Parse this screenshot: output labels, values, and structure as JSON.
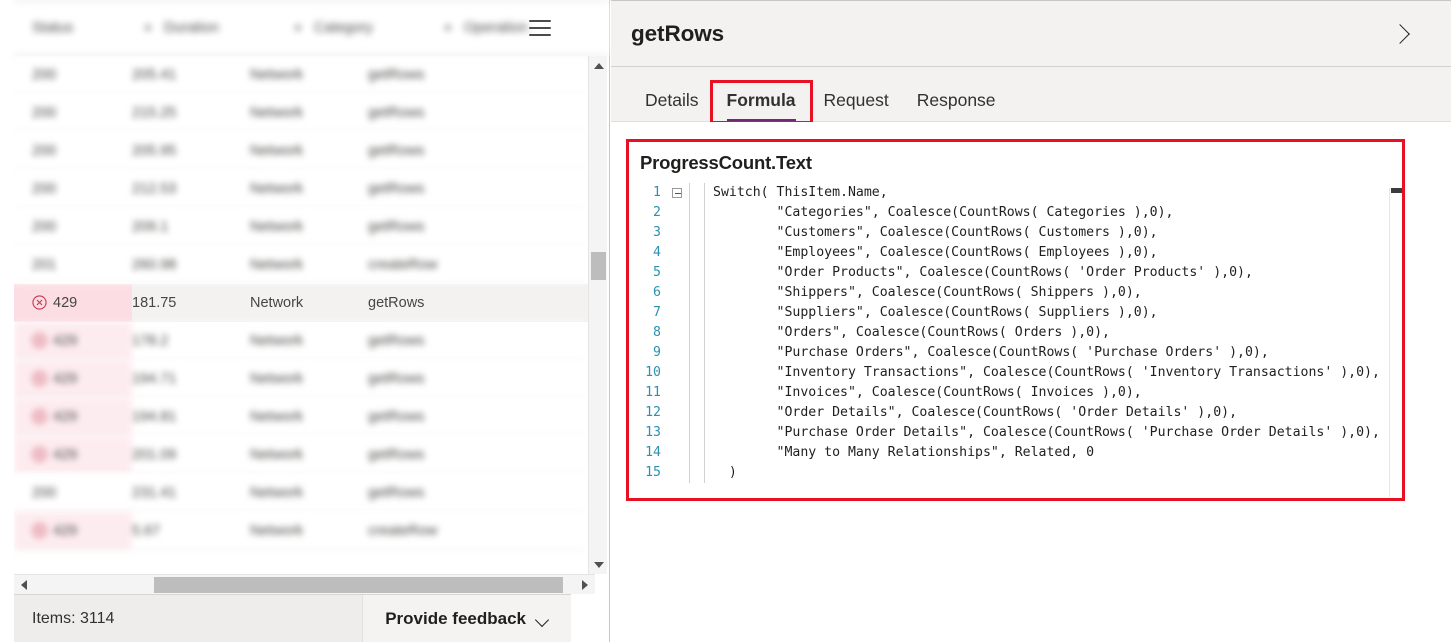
{
  "grid": {
    "columns": [
      "Status",
      "Duration",
      "Category",
      "Operation"
    ],
    "sort_icon": "sort-icon",
    "menu_icon": "hamburger-menu-icon",
    "rows": [
      {
        "status": "200",
        "duration": "205.41",
        "category": "Network",
        "operation": "getRows",
        "error": false,
        "focused": false
      },
      {
        "status": "200",
        "duration": "215.25",
        "category": "Network",
        "operation": "getRows",
        "error": false,
        "focused": false
      },
      {
        "status": "200",
        "duration": "205.95",
        "category": "Network",
        "operation": "getRows",
        "error": false,
        "focused": false
      },
      {
        "status": "200",
        "duration": "212.53",
        "category": "Network",
        "operation": "getRows",
        "error": false,
        "focused": false
      },
      {
        "status": "200",
        "duration": "209.1",
        "category": "Network",
        "operation": "getRows",
        "error": false,
        "focused": false
      },
      {
        "status": "201",
        "duration": "260.98",
        "category": "Network",
        "operation": "createRow",
        "error": false,
        "focused": false
      },
      {
        "status": "429",
        "duration": "181.75",
        "category": "Network",
        "operation": "getRows",
        "error": true,
        "focused": true
      },
      {
        "status": "429",
        "duration": "178.2",
        "category": "Network",
        "operation": "getRows",
        "error": true,
        "focused": false
      },
      {
        "status": "429",
        "duration": "194.71",
        "category": "Network",
        "operation": "getRows",
        "error": true,
        "focused": false
      },
      {
        "status": "429",
        "duration": "194.81",
        "category": "Network",
        "operation": "getRows",
        "error": true,
        "focused": false
      },
      {
        "status": "429",
        "duration": "201.09",
        "category": "Network",
        "operation": "getRows",
        "error": true,
        "focused": false
      },
      {
        "status": "200",
        "duration": "231.41",
        "category": "Network",
        "operation": "getRows",
        "error": false,
        "focused": false
      },
      {
        "status": "429",
        "duration": "5.67",
        "category": "Network",
        "operation": "createRow",
        "error": true,
        "focused": false
      }
    ]
  },
  "statusbar": {
    "items_label": "Items: 3114",
    "feedback_label": "Provide feedback",
    "feedback_chevron": "chevron-down-icon"
  },
  "detail": {
    "title": "getRows",
    "expand_icon": "chevron-right-icon",
    "tabs": [
      {
        "label": "Details",
        "selected": false,
        "highlighted": false
      },
      {
        "label": "Formula",
        "selected": true,
        "highlighted": true
      },
      {
        "label": "Request",
        "selected": false,
        "highlighted": false
      },
      {
        "label": "Response",
        "selected": false,
        "highlighted": false
      }
    ],
    "formula_property": "ProgressCount.Text",
    "code_lines": [
      {
        "num": "1",
        "fold": true,
        "text": "Switch( ThisItem.Name,"
      },
      {
        "num": "2",
        "fold": false,
        "text": "        \"Categories\", Coalesce(CountRows( Categories ),0),"
      },
      {
        "num": "3",
        "fold": false,
        "text": "        \"Customers\", Coalesce(CountRows( Customers ),0),"
      },
      {
        "num": "4",
        "fold": false,
        "text": "        \"Employees\", Coalesce(CountRows( Employees ),0),"
      },
      {
        "num": "5",
        "fold": false,
        "text": "        \"Order Products\", Coalesce(CountRows( 'Order Products' ),0),"
      },
      {
        "num": "6",
        "fold": false,
        "text": "        \"Shippers\", Coalesce(CountRows( Shippers ),0),"
      },
      {
        "num": "7",
        "fold": false,
        "text": "        \"Suppliers\", Coalesce(CountRows( Suppliers ),0),"
      },
      {
        "num": "8",
        "fold": false,
        "text": "        \"Orders\", Coalesce(CountRows( Orders ),0),"
      },
      {
        "num": "9",
        "fold": false,
        "text": "        \"Purchase Orders\", Coalesce(CountRows( 'Purchase Orders' ),0),"
      },
      {
        "num": "10",
        "fold": false,
        "text": "        \"Inventory Transactions\", Coalesce(CountRows( 'Inventory Transactions' ),0),"
      },
      {
        "num": "11",
        "fold": false,
        "text": "        \"Invoices\", Coalesce(CountRows( Invoices ),0),"
      },
      {
        "num": "12",
        "fold": false,
        "text": "        \"Order Details\", Coalesce(CountRows( 'Order Details' ),0),"
      },
      {
        "num": "13",
        "fold": false,
        "text": "        \"Purchase Order Details\", Coalesce(CountRows( 'Purchase Order Details' ),0),"
      },
      {
        "num": "14",
        "fold": false,
        "text": "        \"Many to Many Relationships\", Related, 0"
      },
      {
        "num": "15",
        "fold": false,
        "text": "  )"
      }
    ]
  },
  "colors": {
    "highlight_red": "#e81123",
    "tab_accent_purple": "#742774",
    "error_row_bg": "#fdecef",
    "line_number_blue": "#2b91af"
  }
}
